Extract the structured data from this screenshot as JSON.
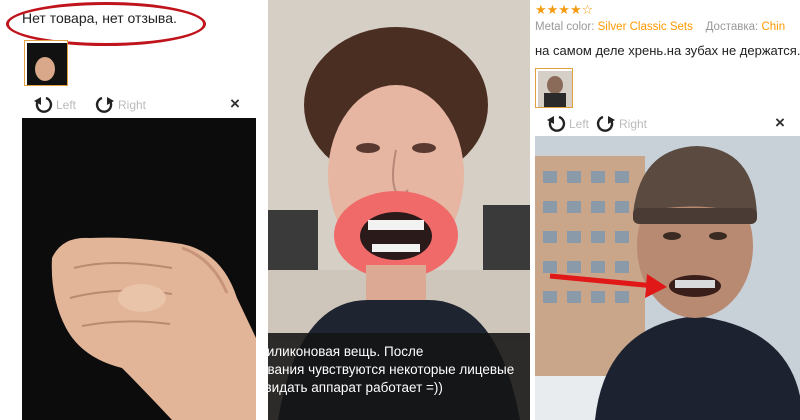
{
  "panel1": {
    "review_text": "Нет товара, нет отзыва.",
    "viewer": {
      "left_label": "Left",
      "right_label": "Right",
      "close_glyph": "×"
    }
  },
  "panel2": {
    "caption_lines": [
      "силиконовая вещь. После",
      "ования чувствуются некоторые лицевые",
      "(видать аппарат работает =))"
    ]
  },
  "panel3": {
    "stars": "★★★★☆",
    "meta": {
      "color_key": "Metal color:",
      "color_value": "Silver Classic Sets",
      "delivery_key": "Доставка:",
      "delivery_value": "Chin"
    },
    "review_text": "на самом деле хрень.на зубах не держатся.",
    "viewer": {
      "left_label": "Left",
      "right_label": "Right",
      "close_glyph": "×"
    }
  },
  "colors": {
    "annotation_red": "#c0141c",
    "star_orange": "#f39c12",
    "meta_value_orange": "#ff9900"
  }
}
